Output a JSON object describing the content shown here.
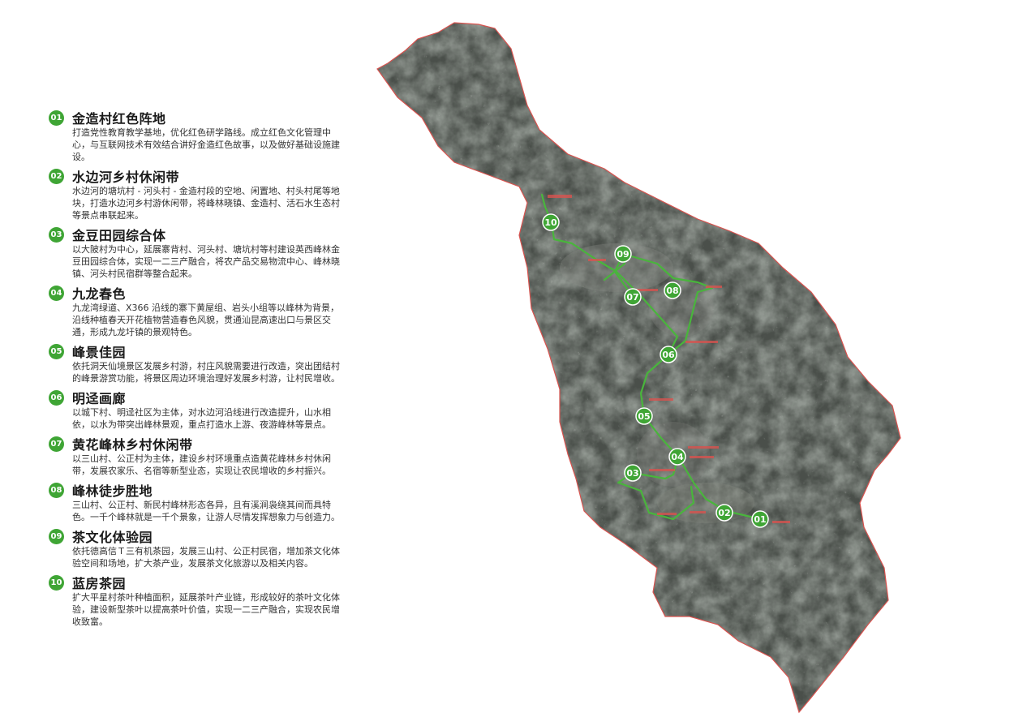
{
  "items": [
    {
      "num": "01",
      "title": "金造村红色阵地",
      "desc": "打造党性教育教学基地，优化红色研学路线。成立红色文化管理中心，与互联网技术有效结合讲好金造红色故事，以及做好基础设施建设。"
    },
    {
      "num": "02",
      "title": "水边河乡村休闲带",
      "desc": "水边河的塘坑村 - 河头村 - 金造村段的空地、闲置地、村头村尾等地块，打造水边河乡村游休闲带，将峰林晓镇、金造村、活石水生态村等景点串联起来。"
    },
    {
      "num": "03",
      "title": "金豆田园综合体",
      "desc": "以大陂村为中心，延展寨背村、河头村、塘坑村等村建设英西峰林金豆田园综合体，实现一二三产融合，将农产品交易物流中心、峰林晓镇、河头村民宿群等整合起来。"
    },
    {
      "num": "04",
      "title": "九龙春色",
      "desc": "九龙湾绿道、X366 沿线的寨下黄屋组、岩头小组等以峰林为背景，沿线种植春天开花植物营造春色风貌，贯通汕昆高速出口与景区交通，形成九龙圩镇的景观特色。"
    },
    {
      "num": "05",
      "title": "峰景佳园",
      "desc": "依托洞天仙境景区发展乡村游，村庄风貌需要进行改造，突出团结村的峰景游赏功能，将景区周边环境治理好发展乡村游，让村民增收。"
    },
    {
      "num": "06",
      "title": "明迳画廊",
      "desc": "以城下村、明迳社区为主体，对水边河沿线进行改造提升，山水相依，以水为带突出峰林景观，重点打造水上游、夜游峰林等景点。"
    },
    {
      "num": "07",
      "title": "黄花峰林乡村休闲带",
      "desc": "以三山村、公正村为主体，建设乡村环境重点造黄花峰林乡村休闲带，发展农家乐、名宿等新型业态，实现让农民增收的乡村振兴。"
    },
    {
      "num": "08",
      "title": "峰林徒步胜地",
      "desc": "三山村、公正村、新民村峰林形态各异，且有溪涧袅绕其间而具特色。一千个峰林就是一千个景象，让游人尽情发挥想象力与创造力。"
    },
    {
      "num": "09",
      "title": "茶文化体验园",
      "desc": "依托德高信Ｔ三有机茶园，发展三山村、公正村民宿，增加茶文化体验空间和场地，扩大茶产业，发展茶文化旅游以及相关内容。"
    },
    {
      "num": "10",
      "title": "蓝房茶园",
      "desc": "扩大平星村茶叶种植面积，延展茶叶产业链，形成较好的茶叶文化体验，建设新型茶叶以提高茶叶价值，实现一二三产融合，实现农民增收致富。"
    }
  ],
  "map": {
    "markers": [
      "01",
      "02",
      "03",
      "04",
      "05",
      "06",
      "07",
      "08",
      "09",
      "10"
    ],
    "colors": {
      "accent": "#3fa535",
      "route": "#49b53c",
      "boundary": "#d9534f",
      "terrain": "#4a4f4a"
    }
  }
}
